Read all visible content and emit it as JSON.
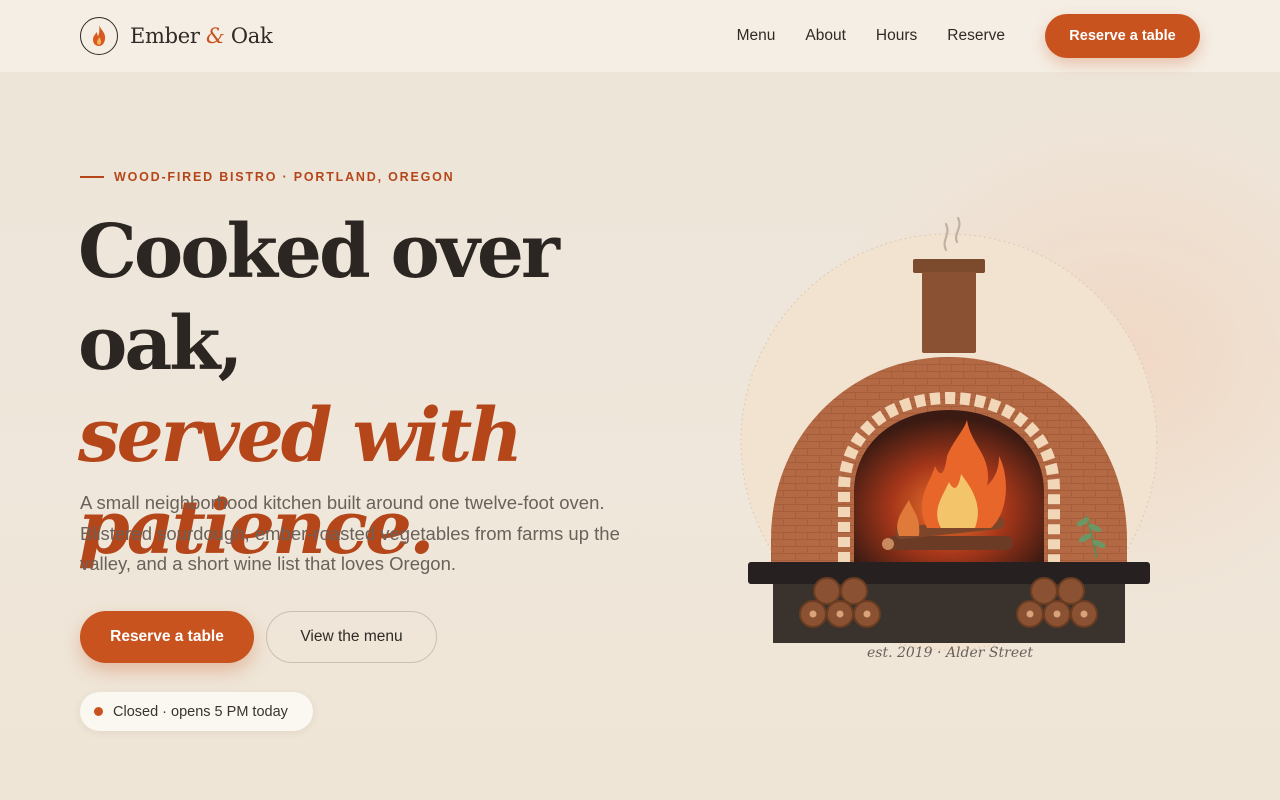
{
  "brand": {
    "name_left": "Ember",
    "ampersand": "&",
    "name_right": "Oak"
  },
  "nav": {
    "links": [
      "Menu",
      "About",
      "Hours",
      "Reserve"
    ],
    "cta": "Reserve a table"
  },
  "hero": {
    "eyebrow": "WOOD-FIRED BISTRO · PORTLAND, OREGON",
    "headline_line1": "Cooked over oak,",
    "headline_line2": "served with",
    "headline_line3": "patience.",
    "lede": "A small neighborhood kitchen built around one twelve-foot oven. Blistered sourdough, ember-roasted vegetables from farms up the valley, and a short wine list that loves Oregon.",
    "primary_button": "Reserve a table",
    "secondary_button": "View the menu",
    "status": "Closed · opens 5 PM today"
  },
  "illustration": {
    "caption": "est. 2019 · Alder Street",
    "icon": "wood-fired-oven-illustration"
  },
  "colors": {
    "accent": "#c8531f",
    "accent_dark": "#b4461a",
    "background": "#efe6da",
    "nav_background": "#f5eee4",
    "text": "#2f2a26"
  }
}
